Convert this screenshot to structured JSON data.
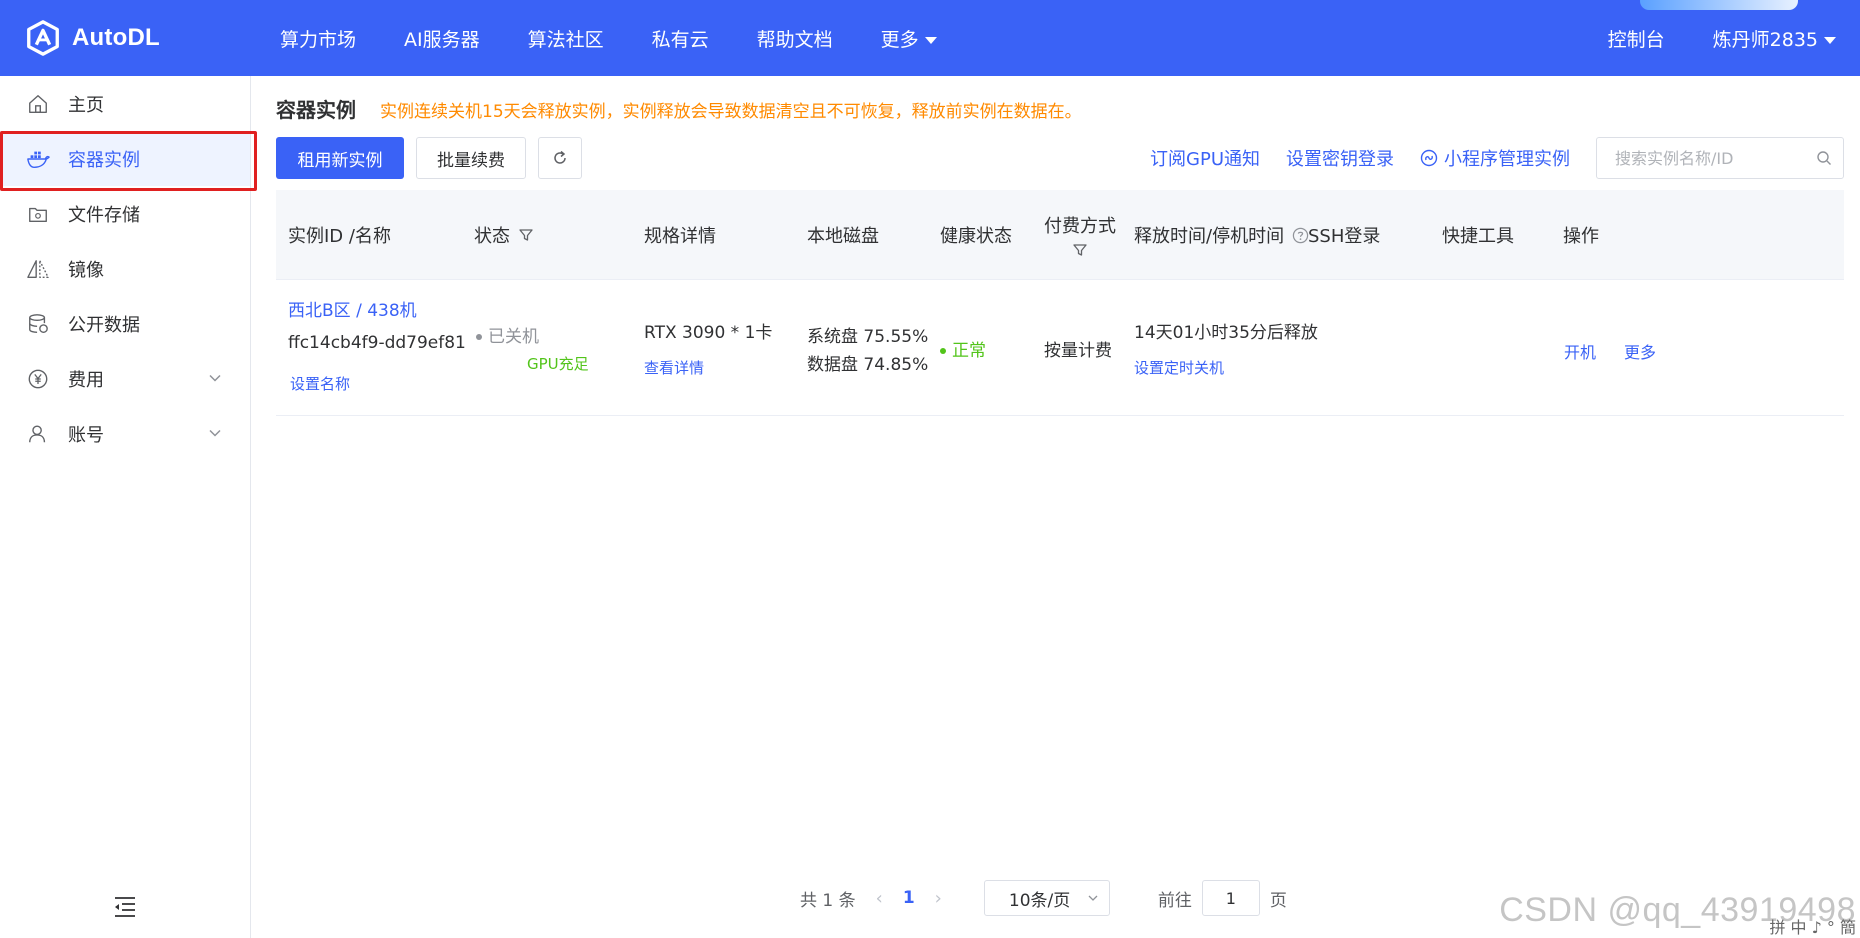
{
  "header": {
    "logo_text": "AutoDL",
    "nav": [
      {
        "label": "算力市场"
      },
      {
        "label": "AI服务器"
      },
      {
        "label": "算法社区"
      },
      {
        "label": "私有云"
      },
      {
        "label": "帮助文档"
      },
      {
        "label": "更多"
      }
    ],
    "console": "控制台",
    "user": "炼丹师2835",
    "accent": "#3a62f6"
  },
  "sidebar": {
    "items": [
      {
        "label": "主页",
        "icon": "home-icon"
      },
      {
        "label": "容器实例",
        "icon": "docker-icon",
        "active": true
      },
      {
        "label": "文件存储",
        "icon": "storage-icon"
      },
      {
        "label": "镜像",
        "icon": "mirror-icon"
      },
      {
        "label": "公开数据",
        "icon": "database-icon"
      },
      {
        "label": "费用",
        "icon": "yuan-icon",
        "expandable": true
      },
      {
        "label": "账号",
        "icon": "user-icon",
        "expandable": true
      }
    ]
  },
  "main": {
    "title": "容器实例",
    "warning": "实例连续关机15天会释放实例，实例释放会导致数据清空且不可恢复，释放前实例在数据在。",
    "rent_button": "租用新实例",
    "renew_button": "批量续费",
    "links": {
      "gpu_notify": "订阅GPU通知",
      "ssh_key": "设置密钥登录",
      "miniapp": "小程序管理实例"
    },
    "search_placeholder": "搜索实例名称/ID"
  },
  "table": {
    "headers": {
      "id": "实例ID /名称",
      "status": "状态",
      "spec": "规格详情",
      "disk": "本地磁盘",
      "health": "健康状态",
      "pay_line1": "付费方式",
      "release": "释放时间/停机时间",
      "ssh": "SSH登录",
      "tools": "快捷工具",
      "ops": "操作"
    },
    "rows": [
      {
        "region": "西北B区 / 438机",
        "id": "ffc14cb4f9-dd79ef81",
        "set_name": "设置名称",
        "status": "已关机",
        "gpu_status": "GPU充足",
        "spec": "RTX 3090 * 1卡",
        "spec_link": "查看详情",
        "sys_disk": "系统盘 75.55%",
        "data_disk": "数据盘 74.85%",
        "health": "正常",
        "pay": "按量计费",
        "release": "14天01小时35分后释放",
        "timer_link": "设置定时关机",
        "op_start": "开机",
        "op_more": "更多"
      }
    ]
  },
  "pagination": {
    "total": "共 1 条",
    "current": "1",
    "page_size": "10条/页",
    "goto_label": "前往",
    "goto_value": "1",
    "page_suffix": "页"
  },
  "watermark": "CSDN @qq_43919498",
  "ime_text": "拼 中 ♪ ° 簡"
}
